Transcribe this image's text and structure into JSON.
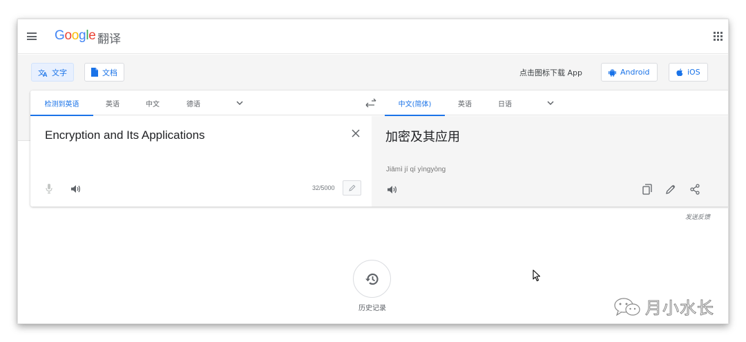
{
  "header": {
    "logo_letters": [
      {
        "char": "G",
        "color": "#4285F4"
      },
      {
        "char": "o",
        "color": "#EA4335"
      },
      {
        "char": "o",
        "color": "#FBBC05"
      },
      {
        "char": "g",
        "color": "#4285F4"
      },
      {
        "char": "l",
        "color": "#34A853"
      },
      {
        "char": "e",
        "color": "#EA4335"
      }
    ],
    "product_name": "翻译",
    "menu_icon": "hamburger-menu-icon",
    "apps_icon": "apps-grid-icon"
  },
  "modes": [
    {
      "label": "文字",
      "icon": "translate-icon",
      "active": true
    },
    {
      "label": "文档",
      "icon": "document-icon",
      "active": false
    }
  ],
  "download": {
    "text": "点击图标下载 App",
    "android_label": "Android",
    "ios_label": "iOS"
  },
  "source_langs": [
    "检测到英语",
    "英语",
    "中文",
    "德语"
  ],
  "target_langs": [
    "中文(简体)",
    "英语",
    "日语"
  ],
  "source": {
    "text": "Encryption and Its Applications",
    "char_count": "32/5000"
  },
  "target": {
    "text": "加密及其应用",
    "pinyin": "Jiāmì jí qí yìngyòng"
  },
  "feedback_label": "发送反馈",
  "history_label": "历史记录",
  "watermark": "月小水长",
  "colors": {
    "accent": "#1a73e8",
    "icon_gray": "#5f6368",
    "target_bg": "#f5f5f5"
  }
}
